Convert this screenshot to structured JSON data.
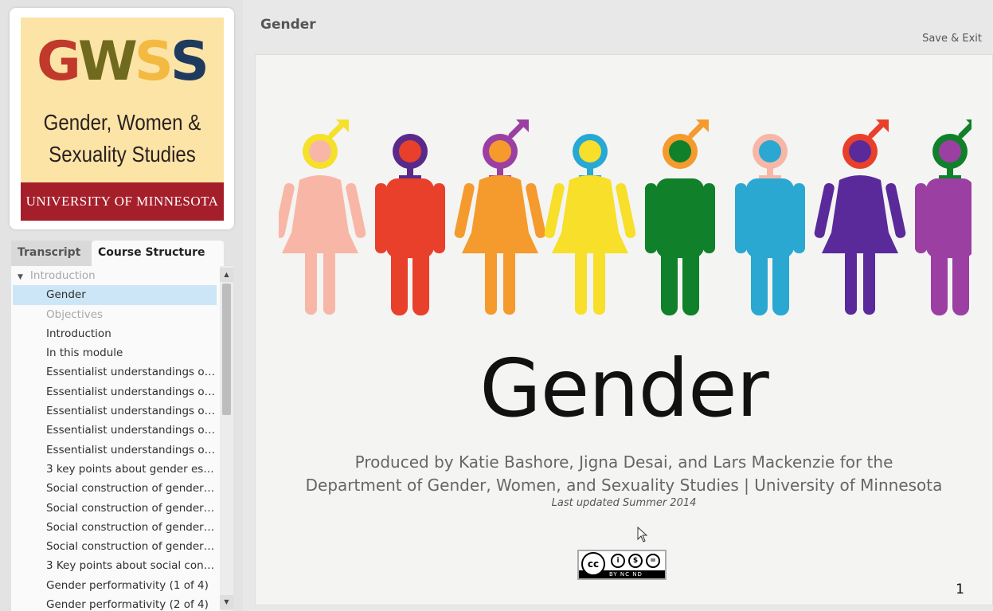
{
  "logo": {
    "letters": [
      "G",
      "W",
      "S",
      "S"
    ],
    "letter_colors": [
      "#c0392b",
      "#6f6a1e",
      "#f4b941",
      "#1e3a5f"
    ],
    "line1": "Gender, Women &",
    "line2": "Sexuality Studies",
    "band": "UNIVERSITY OF MINNESOTA"
  },
  "tabs": {
    "transcript": "Transcript",
    "course_structure": "Course Structure"
  },
  "tree": {
    "section": "Introduction",
    "items": [
      {
        "label": "Gender",
        "state": "selected"
      },
      {
        "label": "Objectives",
        "state": "muted"
      },
      {
        "label": "Introduction",
        "state": "normal"
      },
      {
        "label": "In this module",
        "state": "normal"
      },
      {
        "label": "Essentialist understandings of ...",
        "state": "normal"
      },
      {
        "label": "Essentialist understandings of ...",
        "state": "normal"
      },
      {
        "label": "Essentialist understandings of ...",
        "state": "normal"
      },
      {
        "label": "Essentialist understandings of ...",
        "state": "normal"
      },
      {
        "label": "Essentialist understandings of ...",
        "state": "normal"
      },
      {
        "label": "3 key points about gender ess...",
        "state": "normal"
      },
      {
        "label": "Social construction of gender ...",
        "state": "normal"
      },
      {
        "label": "Social construction of gender ...",
        "state": "normal"
      },
      {
        "label": "Social construction of gender ...",
        "state": "normal"
      },
      {
        "label": "Social construction of gender ...",
        "state": "normal"
      },
      {
        "label": "3 Key points about social cons...",
        "state": "normal"
      },
      {
        "label": "Gender performativity (1 of 4)",
        "state": "normal"
      },
      {
        "label": "Gender performativity (2 of 4)",
        "state": "normal"
      }
    ]
  },
  "main": {
    "title": "Gender",
    "save_exit": "Save & Exit"
  },
  "slide": {
    "heading": "Gender",
    "credit_line1": "Produced by Katie Bashore, Jigna Desai, and Lars Mackenzie for the",
    "credit_line2": "Department of Gender, Women, and Sexuality Studies |  University of Minnesota",
    "updated": "Last updated Summer 2014",
    "page_number": "1",
    "license_labels": "BY  NC  ND",
    "figures": [
      {
        "body": "#f8b7a6",
        "ring": "#f5e02a",
        "head": "#f8b7a6",
        "shape": "dress",
        "symbol": "male"
      },
      {
        "body": "#e8402a",
        "ring": "#5a2a8a",
        "head": "#e8402a",
        "shape": "pants",
        "symbol": "female"
      },
      {
        "body": "#f59a2c",
        "ring": "#9b3fa3",
        "head": "#f59a2c",
        "shape": "dress",
        "symbol": "both"
      },
      {
        "body": "#f7df2a",
        "ring": "#27a9d6",
        "head": "#f7df2a",
        "shape": "dress",
        "symbol": "female"
      },
      {
        "body": "#11802a",
        "ring": "#f59a2c",
        "head": "#11802a",
        "shape": "pants",
        "symbol": "male"
      },
      {
        "body": "#2aa8d2",
        "ring": "#f8b7a6",
        "head": "#2aa8d2",
        "shape": "pants",
        "symbol": "female"
      },
      {
        "body": "#5a2a9a",
        "ring": "#e8402a",
        "head": "#5a2a9a",
        "shape": "dress",
        "symbol": "male"
      },
      {
        "body": "#9b3fa3",
        "ring": "#11802a",
        "head": "#9b3fa3",
        "shape": "pants",
        "symbol": "both"
      }
    ]
  }
}
